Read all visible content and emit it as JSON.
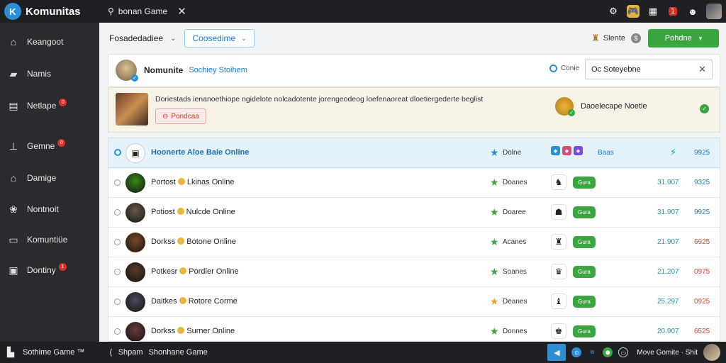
{
  "app": {
    "title": "Komunitas",
    "logo_glyph": "K"
  },
  "topbar": {
    "search_label": "bonan Game",
    "search_glyph": "⚲",
    "close_glyph": "✕",
    "icons": [
      "gear-icon",
      "game-box-icon",
      "grid-icon",
      "notification-icon",
      "profile-icon"
    ],
    "gear_glyph": "⚙",
    "box_glyph": "🎮",
    "grid_glyph": "▦",
    "alert_glyph": "1",
    "user_glyph": "☻"
  },
  "sidebar": {
    "items": [
      {
        "label": "Keangoot",
        "glyph": "⌂",
        "badge": ""
      },
      {
        "label": "Namis",
        "glyph": "▰",
        "badge": ""
      },
      {
        "label": "Netlape",
        "glyph": "▤",
        "badge": "0"
      },
      {
        "label": "Gemne",
        "glyph": "⊥",
        "badge": "0"
      },
      {
        "label": "Damige",
        "glyph": "⌂",
        "badge": ""
      },
      {
        "label": "Nontnoit",
        "glyph": "❀",
        "badge": ""
      },
      {
        "label": "Komuntiüe",
        "glyph": "▭",
        "badge": ""
      },
      {
        "label": "Dontiny",
        "glyph": "▣",
        "badge": "1"
      }
    ]
  },
  "toolbar": {
    "filter_label": "Fosadedadiee",
    "filter_chevron": "⌄",
    "dropdown_label": "Coosedime",
    "dropdown_chevron": "⌄",
    "right_label": "Slente",
    "right_glyph": "♜",
    "info_glyph": "$",
    "button_label": "Pohdne",
    "button_chevron": "▾"
  },
  "panel": {
    "title": "Nomunite",
    "subtitle": "Sochiey Stoihem",
    "option_label": "Conie",
    "search_value": "Oc Soteyebne",
    "clear_glyph": "✕",
    "check_glyph": "✓"
  },
  "banner": {
    "text": "Doriestads ienanoethiope ngidelote nolcadotente jorengeodeog loefenaoreat dloetiergederte beglist",
    "tag_glyph": "⊖",
    "tag_label": "Pondcaa",
    "right_label": "Daoelecape Noetie",
    "dot_glyph": "✓"
  },
  "highlight_row": {
    "name": "Hoonerte Aloe Baie Online",
    "star_glyph": "★",
    "service": "Dolne",
    "pills_label": "Baas",
    "bolt_glyph": "⚡",
    "value": "9925"
  },
  "rows": [
    {
      "name_a": "Portost",
      "name_b": "Lkinas Online",
      "service": "Doanes",
      "star": "green",
      "game_glyph": "♞",
      "pill": "Gura",
      "v1": "31.907",
      "v2": "9325",
      "v2_color": "blue",
      "avatar": "#3a8a1a"
    },
    {
      "name_a": "Potiost",
      "name_b": "Nulcde Online",
      "service": "Doaree",
      "star": "green",
      "game_glyph": "☗",
      "pill": "Gura",
      "v1": "31.907",
      "v2": "9925",
      "v2_color": "blue",
      "avatar": "#6a5a4a"
    },
    {
      "name_a": "Dorkss",
      "name_b": "Botone Online",
      "service": "Acanes",
      "star": "green",
      "game_glyph": "♜",
      "pill": "Gura",
      "v1": "21.907",
      "v2": "6925",
      "v2_color": "red",
      "avatar": "#7a4a2a"
    },
    {
      "name_a": "Potkesr",
      "name_b": "Pordier Online",
      "service": "Soanes",
      "star": "green",
      "game_glyph": "♛",
      "pill": "Gura",
      "v1": "21.207",
      "v2": "0975",
      "v2_color": "red",
      "avatar": "#5a3a28"
    },
    {
      "name_a": "Daitkes",
      "name_b": "Rotore Corme",
      "service": "Deanes",
      "star": "gold",
      "game_glyph": "♝",
      "pill": "Gura",
      "v1": "25.297",
      "v2": "0925",
      "v2_color": "red",
      "avatar": "#4a4a5a"
    },
    {
      "name_a": "Dorkss",
      "name_b": "Surner Online",
      "service": "Donnes",
      "star": "green",
      "game_glyph": "♚",
      "pill": "Gura",
      "v1": "20.907",
      "v2": "6525",
      "v2_color": "red",
      "avatar": "#6a3a3a"
    }
  ],
  "bottombar": {
    "left_label": "Sothime Game ™",
    "left_glyph": "▙",
    "mid_glyph": "⟨",
    "mid_label": "Shpam",
    "mid_sub": "Shonhane Game",
    "right_label": "Move Gomite · Shit",
    "send_glyph": "◀",
    "c1_glyph": "⊙",
    "c2_glyph": "⧉",
    "c3_glyph": "⬢",
    "c4_glyph": "▭"
  },
  "colors": {
    "accent": "#2c8fd6",
    "primary_button": "#3aa63f",
    "alert": "#d9302a",
    "topbar": "#1f2023",
    "sidebar": "#2a2b2e"
  }
}
